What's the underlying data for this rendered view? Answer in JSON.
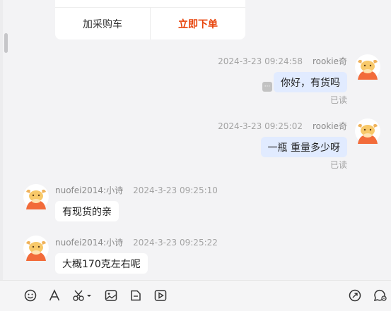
{
  "product_card": {
    "add_to_cart_label": "加采购车",
    "order_now_label": "立即下单"
  },
  "messages": [
    {
      "sender": "rookie奇",
      "time": "2024-3-23 09:24:58",
      "text": "你好，有货吗",
      "status": "已读",
      "side": "right"
    },
    {
      "sender": "rookie奇",
      "time": "2024-3-23 09:25:02",
      "text": "一瓶 重量多少呀",
      "status": "已读",
      "side": "right"
    },
    {
      "sender": "nuofei2014:小诗",
      "time": "2024-3-23 09:25:10",
      "text": "有现货的亲",
      "side": "left"
    },
    {
      "sender": "nuofei2014:小诗",
      "time": "2024-3-23 09:25:22",
      "text": "大概170克左右呢",
      "side": "left"
    }
  ],
  "more_icon_glyph": "···",
  "toolbar": {
    "icons": [
      "emoji-icon",
      "font-icon",
      "scissors-icon",
      "image-icon",
      "file-icon",
      "video-icon",
      "quick-reply-icon",
      "chat-settings-icon"
    ]
  },
  "colors": {
    "accent_order": "#e8430a",
    "my_bubble": "#e1ebff",
    "their_bubble": "#ffffff",
    "background": "#f3f3f5"
  }
}
